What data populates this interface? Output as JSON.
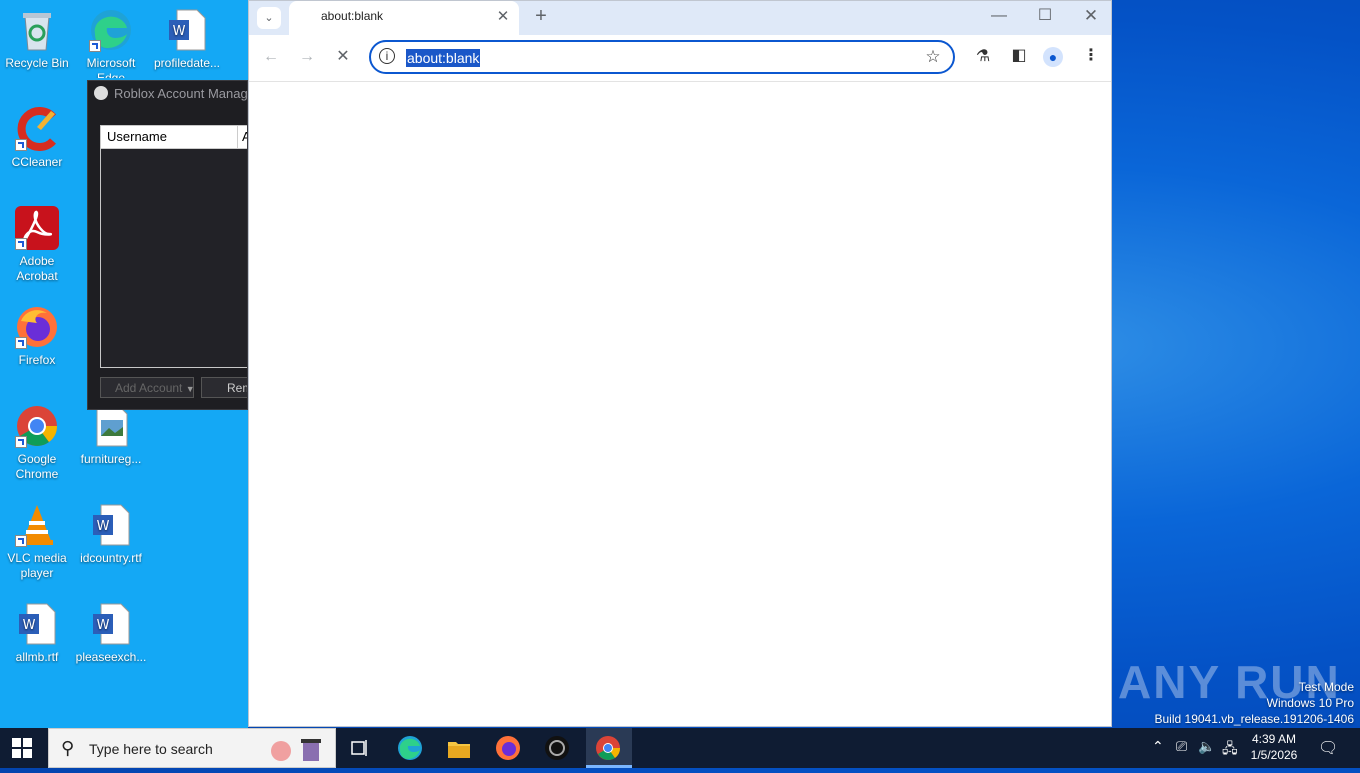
{
  "desktop": {
    "icons": [
      {
        "label": "Recycle Bin"
      },
      {
        "label": "Microsoft Edge"
      },
      {
        "label": "profiledate..."
      },
      {
        "label": "CCleaner"
      },
      {
        "label": "Adobe Acrobat"
      },
      {
        "label": "Firefox"
      },
      {
        "label": "Google Chrome"
      },
      {
        "label": "furnitureg..."
      },
      {
        "label": "VLC media player"
      },
      {
        "label": "idcountry.rtf"
      },
      {
        "label": "allmb.rtf"
      },
      {
        "label": "pleaseexch..."
      }
    ]
  },
  "ram_window": {
    "title": "Roblox Account Manager",
    "columns": [
      "Username",
      "Al"
    ],
    "add_button": "Add Account",
    "remove_button": "Rem"
  },
  "chrome": {
    "tab_title": "about:blank",
    "url": "about:blank"
  },
  "taskbar": {
    "search_placeholder": "Type here to search",
    "time": "4:39 AM",
    "date": "1/5/2026"
  },
  "watermark": {
    "line1": "Test Mode",
    "line2": "Windows 10 Pro",
    "line3": "Build 19041.vb_release.191206-1406",
    "brand": "ANY RUN"
  },
  "colors": {
    "accent": "#0b57d0",
    "taskbar": "#0f1c33"
  }
}
